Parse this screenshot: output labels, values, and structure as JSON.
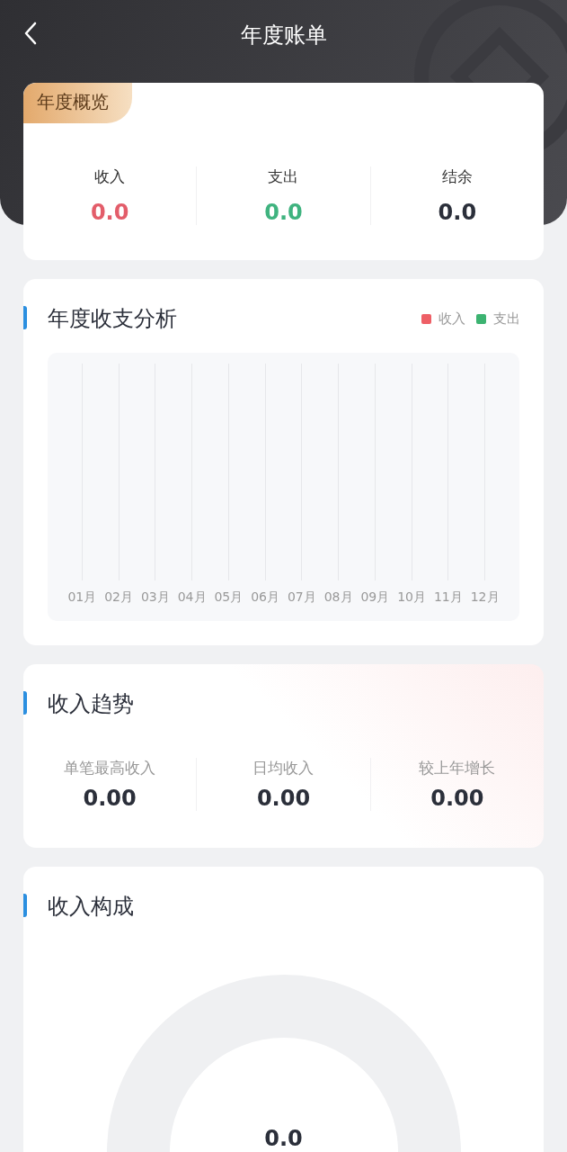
{
  "header": {
    "title": "年度账单"
  },
  "overview": {
    "tag": "年度概览",
    "stats": [
      {
        "label": "收入",
        "value": "0.0",
        "color": "#e35d6a"
      },
      {
        "label": "支出",
        "value": "0.0",
        "color": "#3fb37f"
      },
      {
        "label": "结余",
        "value": "0.0",
        "color": "#2b2f3a"
      }
    ]
  },
  "analysis": {
    "title": "年度收支分析",
    "legend": [
      {
        "label": "收入",
        "color": "#ee5f66"
      },
      {
        "label": "支出",
        "color": "#3cb371"
      }
    ],
    "months": [
      "01月",
      "02月",
      "03月",
      "04月",
      "05月",
      "06月",
      "07月",
      "08月",
      "09月",
      "10月",
      "11月",
      "12月"
    ]
  },
  "trend": {
    "title": "收入趋势",
    "stats": [
      {
        "label": "单笔最高收入",
        "value": "0.00"
      },
      {
        "label": "日均收入",
        "value": "0.00"
      },
      {
        "label": "较上年增长",
        "value": "0.00"
      }
    ]
  },
  "composition": {
    "title": "收入构成",
    "total": "0.0"
  }
}
